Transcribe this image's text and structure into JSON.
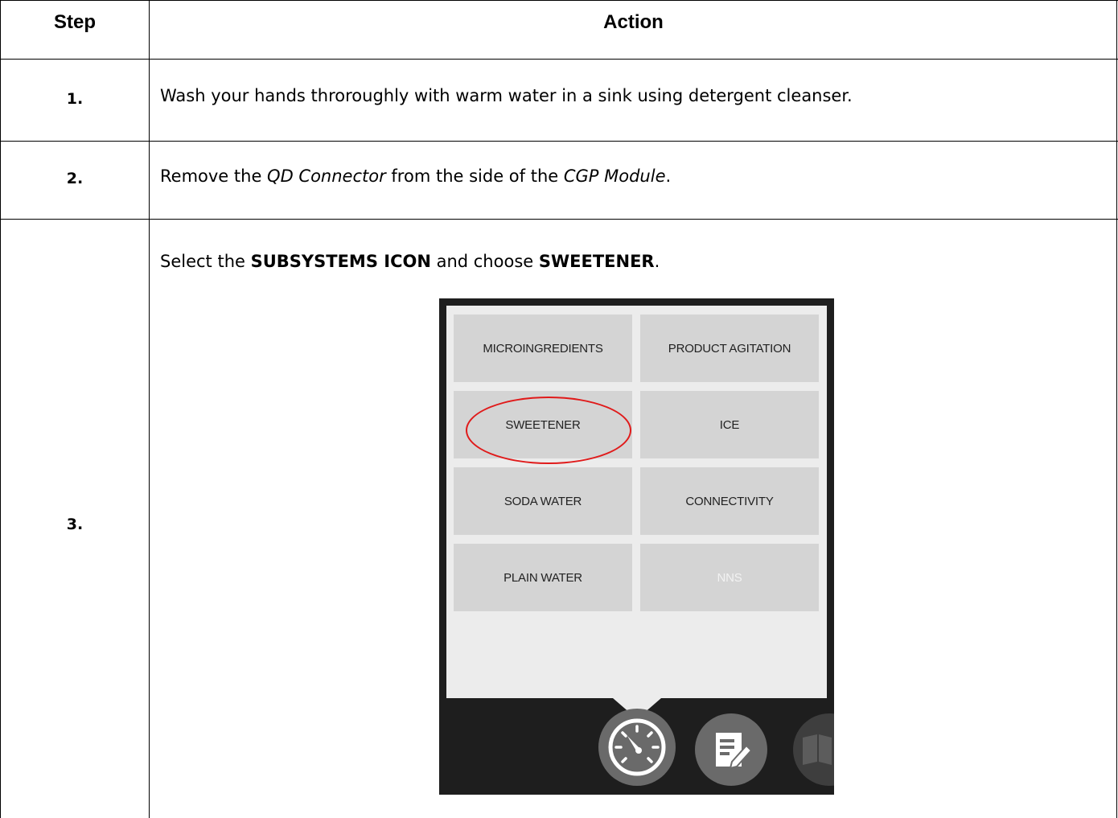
{
  "table": {
    "headers": {
      "step": "Step",
      "action": "Action"
    },
    "rows": [
      {
        "step": "1.",
        "text": "Wash your hands throroughly with warm water in a sink using detergent cleanser."
      },
      {
        "step": "2.",
        "prefix": "Remove the ",
        "item1": "QD Connector",
        "middle": " from the side of the ",
        "item2": "CGP Module",
        "suffix": "."
      },
      {
        "step": "3.",
        "prefix": "Select the ",
        "bold1": "SUBSYSTEMS ICON",
        "middle": " and choose ",
        "bold2": "SWEETENER",
        "suffix": "."
      }
    ]
  },
  "screenshot": {
    "tiles": [
      {
        "label": "MICROINGREDIENTS"
      },
      {
        "label": "PRODUCT AGITATION"
      },
      {
        "label": "SWEETENER"
      },
      {
        "label": "ICE"
      },
      {
        "label": "SODA WATER"
      },
      {
        "label": "CONNECTIVITY"
      },
      {
        "label": "PLAIN WATER"
      },
      {
        "label": "NNS"
      }
    ],
    "highlighted": "SWEETENER",
    "highlight_color": "#e01a1a",
    "icons": [
      "gauge-icon",
      "edit-document-icon",
      "book-icon"
    ]
  }
}
